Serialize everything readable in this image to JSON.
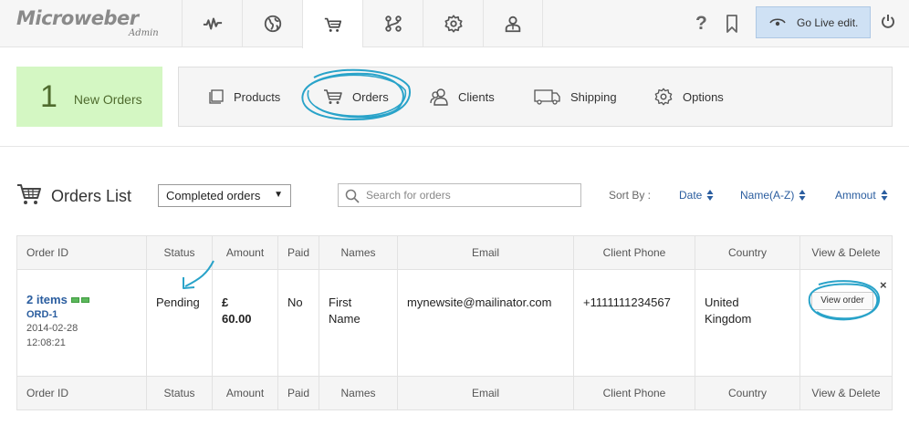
{
  "brand": {
    "name": "Microweber",
    "sub": "Admin"
  },
  "topnav": [
    {
      "name": "stats-icon",
      "active": false
    },
    {
      "name": "website-icon",
      "active": false
    },
    {
      "name": "shop-icon",
      "active": true
    },
    {
      "name": "modules-icon",
      "active": false
    },
    {
      "name": "settings-icon",
      "active": false
    },
    {
      "name": "users-icon",
      "active": false
    }
  ],
  "header": {
    "help": "?",
    "go_live": "Go Live edit."
  },
  "new_orders": {
    "count": "1",
    "label": "New Orders"
  },
  "subnav": {
    "products": "Products",
    "orders": "Orders",
    "clients": "Clients",
    "shipping": "Shipping",
    "options": "Options",
    "active": "Orders"
  },
  "orders_list": {
    "title": "Orders List",
    "filter_selected": "Completed orders",
    "search_placeholder": "Search for orders",
    "sort_by": "Sort By :",
    "sort_date": "Date",
    "sort_name": "Name(A-Z)",
    "sort_amount": "Ammout"
  },
  "table": {
    "headers": [
      "Order ID",
      "Status",
      "Amount",
      "Paid",
      "Names",
      "Email",
      "Client Phone",
      "Country",
      "View & Delete"
    ],
    "rows": [
      {
        "items": "2 items",
        "order_id": "ORD-1",
        "date": "2014-02-28",
        "time": "12:08:21",
        "status": "Pending",
        "amount_currency": "£",
        "amount_value": "60.00",
        "paid": "No",
        "name_first": "First",
        "name_last": "Name",
        "email": "mynewsite@mailinator.com",
        "phone": "+1111111234567",
        "country_1": "United",
        "country_2": "Kingdom",
        "view_label": "View order",
        "delete_label": "×"
      }
    ]
  },
  "colors": {
    "accent": "#2a5d9f",
    "annotation": "#29a3c9",
    "new_orders_bg": "#d4f7c3",
    "go_live_bg": "#cfe1f4"
  }
}
